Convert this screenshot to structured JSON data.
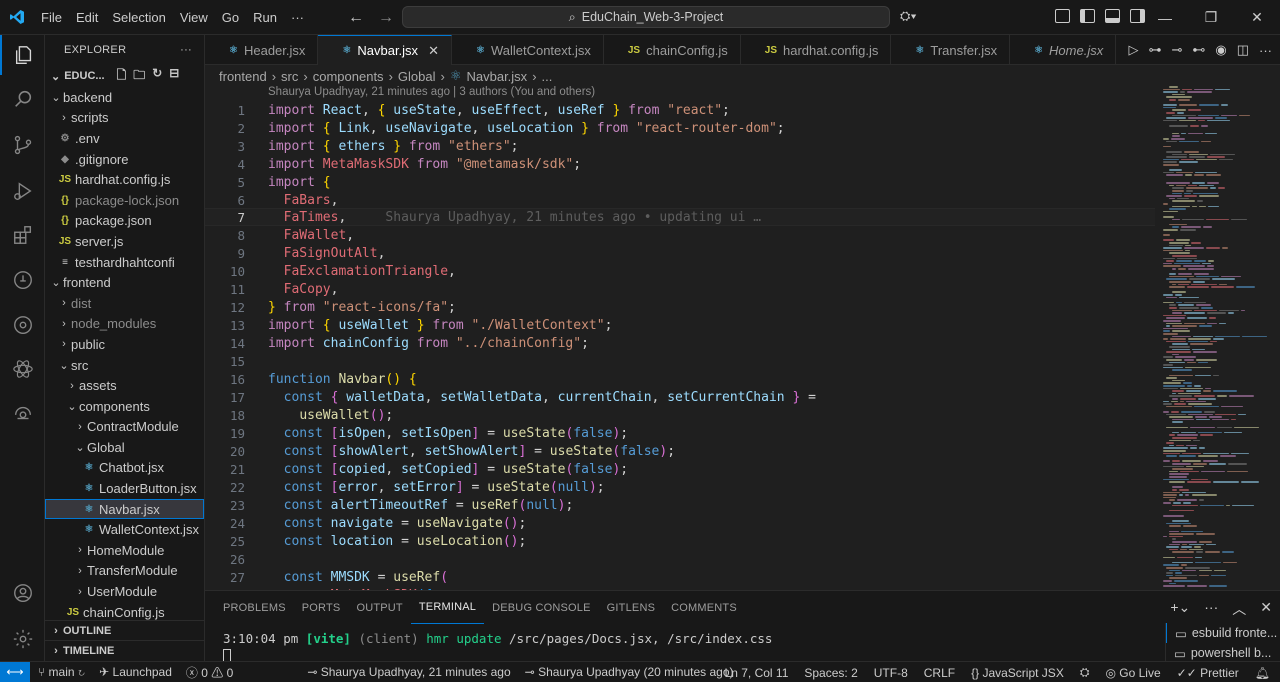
{
  "titlebar": {
    "menu": [
      "File",
      "Edit",
      "Selection",
      "View",
      "Go",
      "Run",
      "···"
    ],
    "search": "EduChain_Web-3-Project"
  },
  "sidebar": {
    "title": "EXPLORER",
    "project": "EDUC...",
    "items": [
      {
        "label": "backend",
        "type": "folder-open",
        "indent": 1
      },
      {
        "label": "scripts",
        "type": "folder",
        "indent": 2
      },
      {
        "label": ".env",
        "type": "env",
        "indent": 2
      },
      {
        "label": ".gitignore",
        "type": "git",
        "indent": 2
      },
      {
        "label": "hardhat.config.js",
        "type": "js",
        "indent": 2
      },
      {
        "label": "package-lock.json",
        "type": "json",
        "indent": 2,
        "dim": true
      },
      {
        "label": "package.json",
        "type": "json",
        "indent": 2
      },
      {
        "label": "server.js",
        "type": "js",
        "indent": 2
      },
      {
        "label": "testhardhahtconfi",
        "type": "txt",
        "indent": 2
      },
      {
        "label": "frontend",
        "type": "folder-open",
        "indent": 1
      },
      {
        "label": "dist",
        "type": "folder",
        "indent": 2,
        "dim": true
      },
      {
        "label": "node_modules",
        "type": "folder",
        "indent": 2,
        "dim": true
      },
      {
        "label": "public",
        "type": "folder",
        "indent": 2
      },
      {
        "label": "src",
        "type": "folder-open",
        "indent": 2
      },
      {
        "label": "assets",
        "type": "folder",
        "indent": 3
      },
      {
        "label": "components",
        "type": "folder-open",
        "indent": 3
      },
      {
        "label": "ContractModule",
        "type": "folder",
        "indent": 4
      },
      {
        "label": "Global",
        "type": "folder-open",
        "indent": 4
      },
      {
        "label": "Chatbot.jsx",
        "type": "react",
        "indent": 5
      },
      {
        "label": "LoaderButton.jsx",
        "type": "react",
        "indent": 5
      },
      {
        "label": "Navbar.jsx",
        "type": "react",
        "indent": 5,
        "selected": true
      },
      {
        "label": "WalletContext.jsx",
        "type": "react",
        "indent": 5
      },
      {
        "label": "HomeModule",
        "type": "folder",
        "indent": 4
      },
      {
        "label": "TransferModule",
        "type": "folder",
        "indent": 4
      },
      {
        "label": "UserModule",
        "type": "folder",
        "indent": 4
      },
      {
        "label": "chainConfig.js",
        "type": "js",
        "indent": 3
      }
    ],
    "outline": "OUTLINE",
    "timeline": "TIMELINE"
  },
  "tabs": [
    {
      "label": "Header.jsx",
      "type": "react"
    },
    {
      "label": "Navbar.jsx",
      "type": "react",
      "active": true
    },
    {
      "label": "WalletContext.jsx",
      "type": "react"
    },
    {
      "label": "chainConfig.js",
      "type": "js"
    },
    {
      "label": "hardhat.config.js",
      "type": "js"
    },
    {
      "label": "Transfer.jsx",
      "type": "react"
    },
    {
      "label": "Home.jsx",
      "type": "react",
      "italic": true
    }
  ],
  "breadcrumb": [
    "frontend",
    "src",
    "components",
    "Global",
    "Navbar.jsx",
    "..."
  ],
  "blame_header": "Shaurya Upadhyay, 21 minutes ago | 3 authors (You and others)",
  "inline_blame": "Shaurya Upadhyay, 21 minutes ago • updating ui …",
  "current_line": 7,
  "panel": {
    "tabs": [
      "PROBLEMS",
      "PORTS",
      "OUTPUT",
      "TERMINAL",
      "DEBUG CONSOLE",
      "GITLENS",
      "COMMENTS"
    ],
    "active_tab": "TERMINAL",
    "terminal_time": "3:10:04 pm",
    "terminal_tag": "[vite]",
    "terminal_client": "(client)",
    "terminal_msg": "hmr update",
    "terminal_paths": "/src/pages/Docs.jsx, /src/index.css",
    "terminals": [
      "esbuild fronte...",
      "powershell b..."
    ]
  },
  "statusbar": {
    "branch": "main",
    "launchpad": "Launchpad",
    "errors": "0",
    "warnings": "0",
    "blame": "Shaurya Upadhyay, 21 minutes ago",
    "blame2": "Shaurya Upadhyay (20 minutes ago)",
    "position": "Ln 7, Col 11",
    "spaces": "Spaces: 2",
    "encoding": "UTF-8",
    "eol": "CRLF",
    "language": "JavaScript JSX",
    "golive": "Go Live",
    "prettier": "Prettier"
  },
  "colors": {
    "accent": "#0078d4",
    "keyword": "#c586c0",
    "string": "#ce9178",
    "variable": "#9cdcfe",
    "function": "#dcdcaa",
    "identifier_red": "#e06c75"
  }
}
